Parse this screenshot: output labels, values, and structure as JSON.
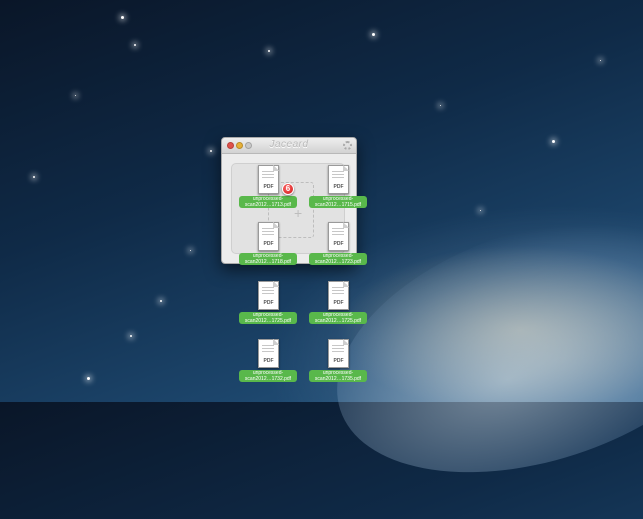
{
  "window": {
    "title": "Jaceard",
    "doc_type_label": "PDF"
  },
  "badge": {
    "count": "6"
  },
  "files": [
    {
      "line1": "unprocessed-",
      "line2": "scan2012…1713.pdf",
      "doc_type": "PDF"
    },
    {
      "line1": "unprocessed-",
      "line2": "scan2012…1715.pdf",
      "doc_type": "PDF"
    },
    {
      "line1": "unprocessed-",
      "line2": "scan2012…1718.pdf",
      "doc_type": "PDF"
    },
    {
      "line1": "unprocessed-",
      "line2": "scan2012…1723.pdf",
      "doc_type": "PDF"
    },
    {
      "line1": "unprocessed-",
      "line2": "scan2012…1725.pdf",
      "doc_type": "PDF"
    },
    {
      "line1": "unprocessed-",
      "line2": "scan2012…1725.pdf",
      "doc_type": "PDF"
    },
    {
      "line1": "unprocessed-",
      "line2": "scan2012…1732.pdf",
      "doc_type": "PDF"
    },
    {
      "line1": "unprocessed-",
      "line2": "scan2012…1735.pdf",
      "doc_type": "PDF"
    }
  ],
  "colors": {
    "label_green": "#59b84b",
    "badge_red": "#cc1515",
    "close": "#e0524b",
    "minimize": "#e7b138"
  }
}
